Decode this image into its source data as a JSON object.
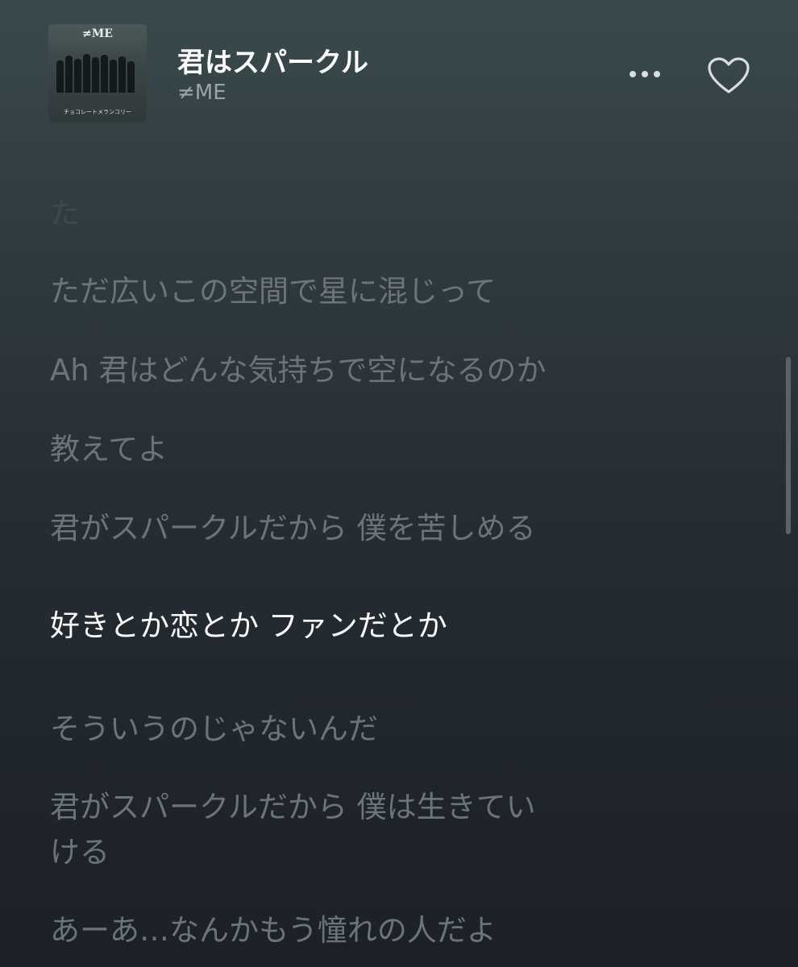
{
  "now_playing": {
    "title": "君はスパークル",
    "artist": "≠ME",
    "album_art": {
      "title_text": "≠ME",
      "subtitle_text": "チョコレートメランコリー"
    }
  },
  "icons": {
    "more": "more-horizontal-icon",
    "favorite": "heart-outline-icon"
  },
  "lyrics": [
    "た",
    "ただ広いこの空間で星に混じって",
    "Ah 君はどんな気持ちで空になるのか",
    "教えてよ",
    "君がスパークルだから 僕を苦しめる",
    "好きとか恋とか ファンだとか",
    "そういうのじゃないんだ",
    "君がスパークルだから 僕は生きてい",
    "ける",
    "あーあ…なんかもう憧れの人だよ"
  ],
  "active_lyric_index": 5,
  "colors": {
    "active_text": "#ffffff",
    "inactive_text": "#6d7479"
  }
}
